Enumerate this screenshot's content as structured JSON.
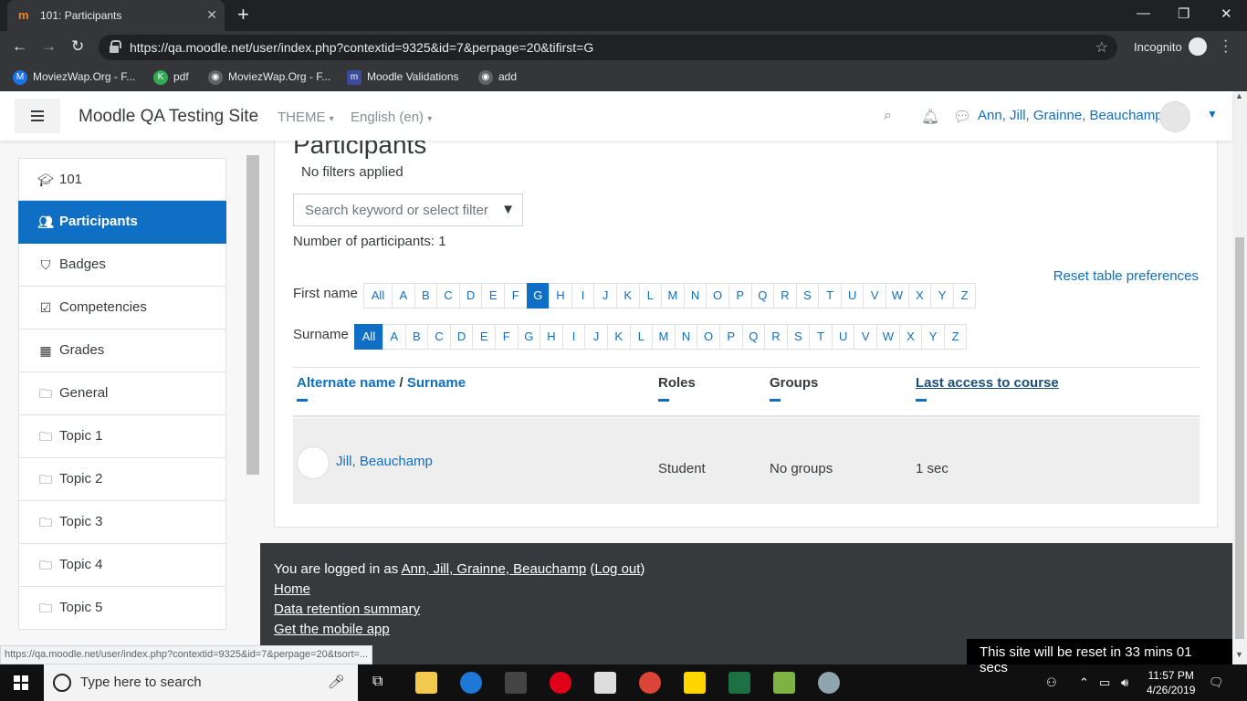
{
  "browser": {
    "tab_title": "101: Participants",
    "tab_favicon": "m",
    "url": "https://qa.moodle.net/user/index.php?contextid=9325&id=7&perpage=20&tifirst=G",
    "incognito_label": "Incognito",
    "bookmarks": [
      {
        "label": "MoviezWap.Org - F...",
        "icon": "moviezwap-icon",
        "color": "#1a73e8"
      },
      {
        "label": "pdf",
        "icon": "pdf-icon",
        "color": "#34a853"
      },
      {
        "label": "MoviezWap.Org - F...",
        "icon": "globe-icon",
        "color": "#5f6368"
      },
      {
        "label": "Moodle Validations",
        "icon": "moodle-icon",
        "color": "#3c4a9b"
      },
      {
        "label": "add",
        "icon": "globe-icon",
        "color": "#5f6368"
      }
    ],
    "status_url": "https://qa.moodle.net/user/index.php?contextid=9325&id=7&perpage=20&tsort=..."
  },
  "navbar": {
    "site_name": "Moodle QA Testing Site",
    "theme_label": "THEME",
    "language_label": "English (en)",
    "user_name": "Ann, Jill, Grainne, Beauchamp"
  },
  "drawer": {
    "items": [
      {
        "label": "101",
        "icon": "graduation-cap-icon"
      },
      {
        "label": "Participants",
        "icon": "users-icon",
        "active": true
      },
      {
        "label": "Badges",
        "icon": "shield-icon"
      },
      {
        "label": "Competencies",
        "icon": "checkbox-icon"
      },
      {
        "label": "Grades",
        "icon": "table-icon"
      },
      {
        "label": "General",
        "icon": "folder-icon"
      },
      {
        "label": "Topic 1",
        "icon": "folder-icon"
      },
      {
        "label": "Topic 2",
        "icon": "folder-icon"
      },
      {
        "label": "Topic 3",
        "icon": "folder-icon"
      },
      {
        "label": "Topic 4",
        "icon": "folder-icon"
      },
      {
        "label": "Topic 5",
        "icon": "folder-icon"
      }
    ]
  },
  "main": {
    "heading": "Participants",
    "no_filters": "No filters applied",
    "filter_placeholder": "Search keyword or select filter",
    "participant_count": "Number of participants: 1",
    "reset_link": "Reset table preferences",
    "first_name_label": "First name",
    "surname_label": "Surname",
    "first_name_selected": "G",
    "surname_selected": "All",
    "letters": [
      "All",
      "A",
      "B",
      "C",
      "D",
      "E",
      "F",
      "G",
      "H",
      "I",
      "J",
      "K",
      "L",
      "M",
      "N",
      "O",
      "P",
      "Q",
      "R",
      "S",
      "T",
      "U",
      "V",
      "W",
      "X",
      "Y",
      "Z"
    ],
    "table": {
      "col_name_a": "Alternate name",
      "col_name_sep": " / ",
      "col_name_b": "Surname",
      "col_roles": "Roles",
      "col_groups": "Groups",
      "col_last_access": "Last access to course",
      "rows": [
        {
          "name": "Jill, Beauchamp",
          "role": "Student",
          "groups": "No groups",
          "last_access": "1 sec"
        }
      ]
    }
  },
  "footer": {
    "logged_in_prefix": "You are logged in as ",
    "user_link": "Ann, Jill, Grainne, Beauchamp",
    "logout_open": " (",
    "logout": "Log out",
    "logout_close": ")",
    "home": "Home",
    "data_retention": "Data retention summary",
    "mobile_app": "Get the mobile app",
    "reset_notice": "This site will be reset in 33 mins 01 secs"
  },
  "taskbar": {
    "search_placeholder": "Type here to search",
    "time": "11:57 PM",
    "date": "4/26/2019"
  }
}
